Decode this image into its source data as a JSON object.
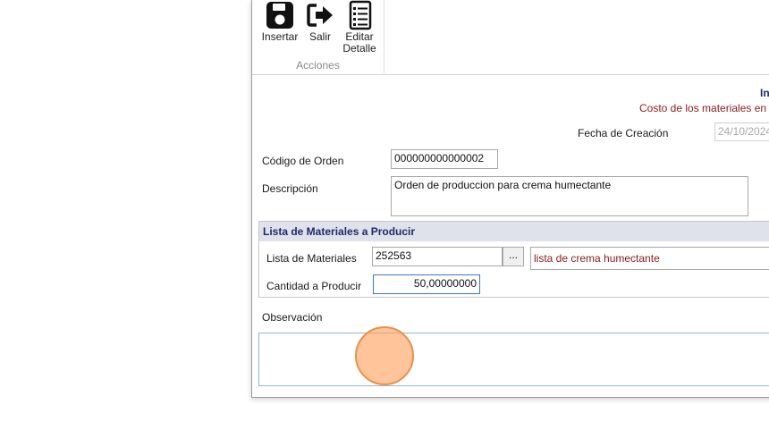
{
  "ribbon": {
    "buttons": [
      {
        "label": "Insertar",
        "icon": "save-icon"
      },
      {
        "label": "Salir",
        "icon": "exit-icon"
      },
      {
        "label": "Editar\nDetalle",
        "label_line1": "Editar",
        "label_line2": "Detalle",
        "icon": "list-icon"
      }
    ],
    "group_label": "Acciones"
  },
  "header": {
    "title": "In",
    "subtitle": "Costo de los materiales en"
  },
  "form": {
    "fecha_label": "Fecha de Creación",
    "fecha_value": "24/10/2024",
    "codigo_label": "Código de Orden",
    "codigo_value": "000000000000002",
    "descripcion_label": "Descripción",
    "descripcion_value": "Orden de produccion para crema humectante"
  },
  "materials_group": {
    "title": "Lista de Materiales a Producir",
    "lista_label": "Lista de Materiales",
    "lista_code": "252563",
    "browse_label": "...",
    "lista_name": "lista de crema humectante",
    "cantidad_label": "Cantidad a Producir",
    "cantidad_value": "50,00000000"
  },
  "observacion": {
    "label": "Observación",
    "value": ""
  },
  "colors": {
    "title": "#1f2a6b",
    "subtitle": "#8b1a1a",
    "group_header_bg": "#dfe2ea",
    "focus_border": "#3b78c4",
    "cursor": "#ffa05a"
  }
}
